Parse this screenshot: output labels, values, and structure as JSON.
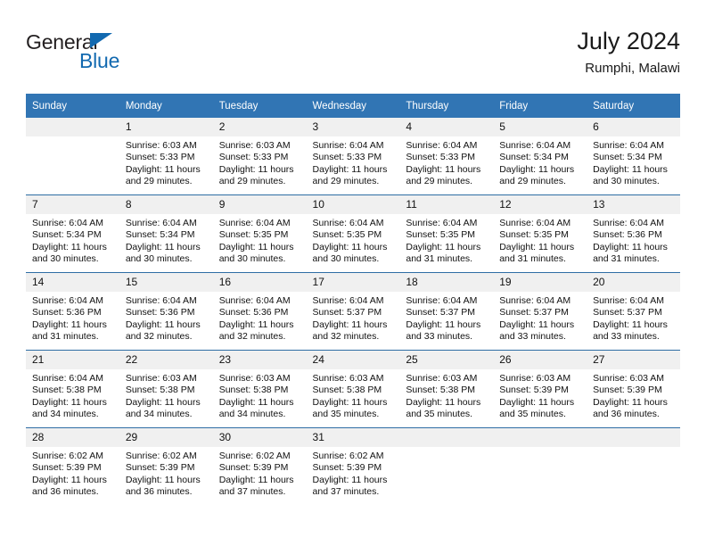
{
  "brand": {
    "name_primary": "General",
    "name_secondary": "Blue",
    "accent_color": "#1269b0"
  },
  "header": {
    "title": "July 2024",
    "subtitle": "Rumphi, Malawi"
  },
  "theme": {
    "header_blue": "#3175b4",
    "row_rule_blue": "#2e6da4",
    "daynum_band": "#f0f0f0"
  },
  "weekday_headers": [
    "Sunday",
    "Monday",
    "Tuesday",
    "Wednesday",
    "Thursday",
    "Friday",
    "Saturday"
  ],
  "weeks": [
    [
      {
        "day": "",
        "sunrise": "",
        "sunset": "",
        "daylight": "",
        "empty": true
      },
      {
        "day": "1",
        "sunrise": "Sunrise: 6:03 AM",
        "sunset": "Sunset: 5:33 PM",
        "daylight": "Daylight: 11 hours and 29 minutes.",
        "empty": false
      },
      {
        "day": "2",
        "sunrise": "Sunrise: 6:03 AM",
        "sunset": "Sunset: 5:33 PM",
        "daylight": "Daylight: 11 hours and 29 minutes.",
        "empty": false
      },
      {
        "day": "3",
        "sunrise": "Sunrise: 6:04 AM",
        "sunset": "Sunset: 5:33 PM",
        "daylight": "Daylight: 11 hours and 29 minutes.",
        "empty": false
      },
      {
        "day": "4",
        "sunrise": "Sunrise: 6:04 AM",
        "sunset": "Sunset: 5:33 PM",
        "daylight": "Daylight: 11 hours and 29 minutes.",
        "empty": false
      },
      {
        "day": "5",
        "sunrise": "Sunrise: 6:04 AM",
        "sunset": "Sunset: 5:34 PM",
        "daylight": "Daylight: 11 hours and 29 minutes.",
        "empty": false
      },
      {
        "day": "6",
        "sunrise": "Sunrise: 6:04 AM",
        "sunset": "Sunset: 5:34 PM",
        "daylight": "Daylight: 11 hours and 30 minutes.",
        "empty": false
      }
    ],
    [
      {
        "day": "7",
        "sunrise": "Sunrise: 6:04 AM",
        "sunset": "Sunset: 5:34 PM",
        "daylight": "Daylight: 11 hours and 30 minutes.",
        "empty": false
      },
      {
        "day": "8",
        "sunrise": "Sunrise: 6:04 AM",
        "sunset": "Sunset: 5:34 PM",
        "daylight": "Daylight: 11 hours and 30 minutes.",
        "empty": false
      },
      {
        "day": "9",
        "sunrise": "Sunrise: 6:04 AM",
        "sunset": "Sunset: 5:35 PM",
        "daylight": "Daylight: 11 hours and 30 minutes.",
        "empty": false
      },
      {
        "day": "10",
        "sunrise": "Sunrise: 6:04 AM",
        "sunset": "Sunset: 5:35 PM",
        "daylight": "Daylight: 11 hours and 30 minutes.",
        "empty": false
      },
      {
        "day": "11",
        "sunrise": "Sunrise: 6:04 AM",
        "sunset": "Sunset: 5:35 PM",
        "daylight": "Daylight: 11 hours and 31 minutes.",
        "empty": false
      },
      {
        "day": "12",
        "sunrise": "Sunrise: 6:04 AM",
        "sunset": "Sunset: 5:35 PM",
        "daylight": "Daylight: 11 hours and 31 minutes.",
        "empty": false
      },
      {
        "day": "13",
        "sunrise": "Sunrise: 6:04 AM",
        "sunset": "Sunset: 5:36 PM",
        "daylight": "Daylight: 11 hours and 31 minutes.",
        "empty": false
      }
    ],
    [
      {
        "day": "14",
        "sunrise": "Sunrise: 6:04 AM",
        "sunset": "Sunset: 5:36 PM",
        "daylight": "Daylight: 11 hours and 31 minutes.",
        "empty": false
      },
      {
        "day": "15",
        "sunrise": "Sunrise: 6:04 AM",
        "sunset": "Sunset: 5:36 PM",
        "daylight": "Daylight: 11 hours and 32 minutes.",
        "empty": false
      },
      {
        "day": "16",
        "sunrise": "Sunrise: 6:04 AM",
        "sunset": "Sunset: 5:36 PM",
        "daylight": "Daylight: 11 hours and 32 minutes.",
        "empty": false
      },
      {
        "day": "17",
        "sunrise": "Sunrise: 6:04 AM",
        "sunset": "Sunset: 5:37 PM",
        "daylight": "Daylight: 11 hours and 32 minutes.",
        "empty": false
      },
      {
        "day": "18",
        "sunrise": "Sunrise: 6:04 AM",
        "sunset": "Sunset: 5:37 PM",
        "daylight": "Daylight: 11 hours and 33 minutes.",
        "empty": false
      },
      {
        "day": "19",
        "sunrise": "Sunrise: 6:04 AM",
        "sunset": "Sunset: 5:37 PM",
        "daylight": "Daylight: 11 hours and 33 minutes.",
        "empty": false
      },
      {
        "day": "20",
        "sunrise": "Sunrise: 6:04 AM",
        "sunset": "Sunset: 5:37 PM",
        "daylight": "Daylight: 11 hours and 33 minutes.",
        "empty": false
      }
    ],
    [
      {
        "day": "21",
        "sunrise": "Sunrise: 6:04 AM",
        "sunset": "Sunset: 5:38 PM",
        "daylight": "Daylight: 11 hours and 34 minutes.",
        "empty": false
      },
      {
        "day": "22",
        "sunrise": "Sunrise: 6:03 AM",
        "sunset": "Sunset: 5:38 PM",
        "daylight": "Daylight: 11 hours and 34 minutes.",
        "empty": false
      },
      {
        "day": "23",
        "sunrise": "Sunrise: 6:03 AM",
        "sunset": "Sunset: 5:38 PM",
        "daylight": "Daylight: 11 hours and 34 minutes.",
        "empty": false
      },
      {
        "day": "24",
        "sunrise": "Sunrise: 6:03 AM",
        "sunset": "Sunset: 5:38 PM",
        "daylight": "Daylight: 11 hours and 35 minutes.",
        "empty": false
      },
      {
        "day": "25",
        "sunrise": "Sunrise: 6:03 AM",
        "sunset": "Sunset: 5:38 PM",
        "daylight": "Daylight: 11 hours and 35 minutes.",
        "empty": false
      },
      {
        "day": "26",
        "sunrise": "Sunrise: 6:03 AM",
        "sunset": "Sunset: 5:39 PM",
        "daylight": "Daylight: 11 hours and 35 minutes.",
        "empty": false
      },
      {
        "day": "27",
        "sunrise": "Sunrise: 6:03 AM",
        "sunset": "Sunset: 5:39 PM",
        "daylight": "Daylight: 11 hours and 36 minutes.",
        "empty": false
      }
    ],
    [
      {
        "day": "28",
        "sunrise": "Sunrise: 6:02 AM",
        "sunset": "Sunset: 5:39 PM",
        "daylight": "Daylight: 11 hours and 36 minutes.",
        "empty": false
      },
      {
        "day": "29",
        "sunrise": "Sunrise: 6:02 AM",
        "sunset": "Sunset: 5:39 PM",
        "daylight": "Daylight: 11 hours and 36 minutes.",
        "empty": false
      },
      {
        "day": "30",
        "sunrise": "Sunrise: 6:02 AM",
        "sunset": "Sunset: 5:39 PM",
        "daylight": "Daylight: 11 hours and 37 minutes.",
        "empty": false
      },
      {
        "day": "31",
        "sunrise": "Sunrise: 6:02 AM",
        "sunset": "Sunset: 5:39 PM",
        "daylight": "Daylight: 11 hours and 37 minutes.",
        "empty": false
      },
      {
        "day": "",
        "sunrise": "",
        "sunset": "",
        "daylight": "",
        "empty": true
      },
      {
        "day": "",
        "sunrise": "",
        "sunset": "",
        "daylight": "",
        "empty": true
      },
      {
        "day": "",
        "sunrise": "",
        "sunset": "",
        "daylight": "",
        "empty": true
      }
    ]
  ]
}
